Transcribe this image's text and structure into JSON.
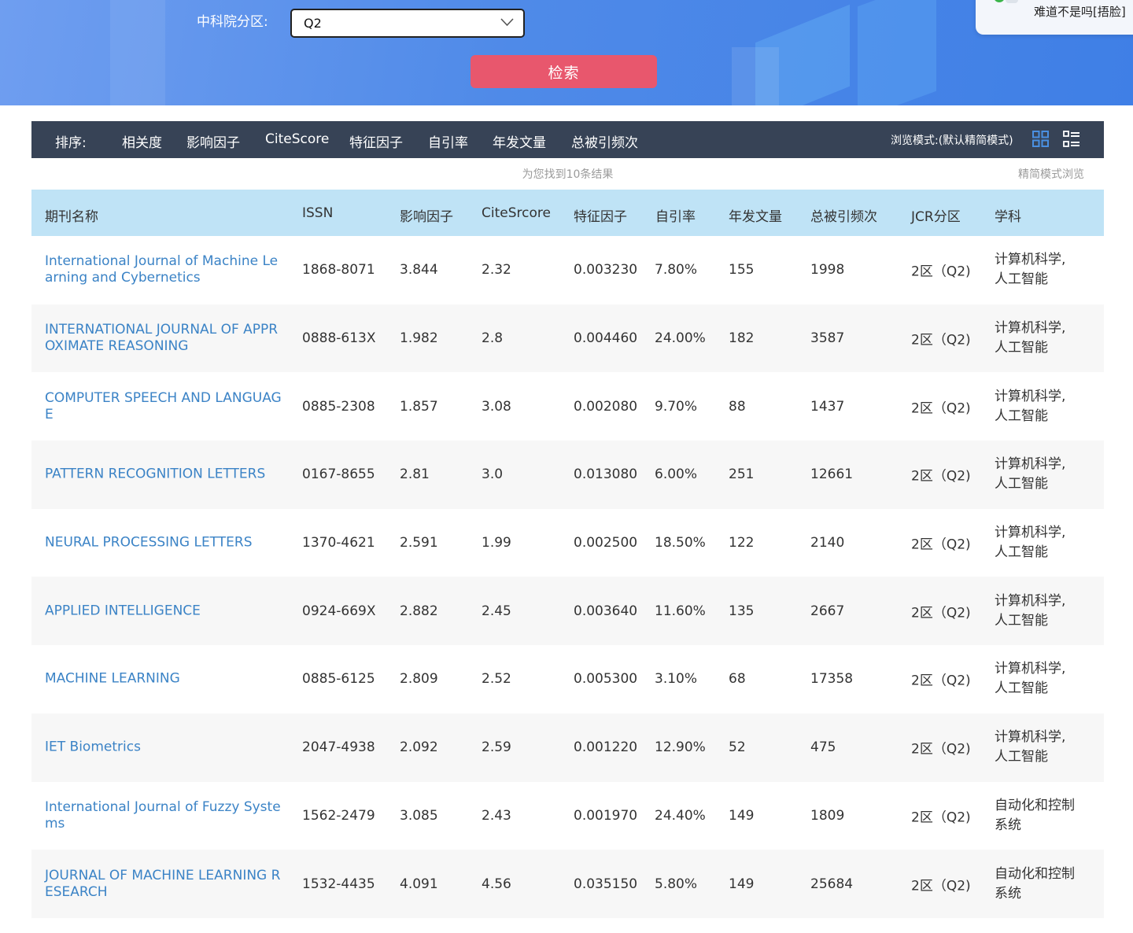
{
  "filter": {
    "label": "中科院分区:",
    "selected": "Q2",
    "search_button": "检索"
  },
  "notification": {
    "text": "难道不是吗[捂脸]"
  },
  "sortbar": {
    "label": "排序:",
    "options": [
      "相关度",
      "影响因子",
      "CiteScore",
      "特征因子",
      "自引率",
      "年发文量",
      "总被引频次"
    ],
    "view_mode_label": "浏览模式:(默认精简模式)",
    "icons": [
      "grid-view-icon",
      "list-view-icon"
    ],
    "icon_color": "#4a90e2"
  },
  "results": {
    "count_text": "为您找到10条结果",
    "simple_mode_text": "精简模式浏览"
  },
  "table": {
    "columns": [
      "期刊名称",
      "ISSN",
      "影响因子",
      "CiteSrcore",
      "特征因子",
      "自引率",
      "年发文量",
      "总被引频次",
      "JCR分区",
      "学科"
    ],
    "rows": [
      {
        "name": "International Journal of Machine Learning and Cybernetics",
        "issn": "1868-8071",
        "if": "3.844",
        "citescore": "2.32",
        "eigen": "0.003230",
        "self": "7.80%",
        "annual": "155",
        "cites": "1998",
        "jcr": "2区（Q2)",
        "subject": "计算机科学, 人工智能"
      },
      {
        "name": "INTERNATIONAL JOURNAL OF APPROXIMATE REASONING",
        "issn": "0888-613X",
        "if": "1.982",
        "citescore": "2.8",
        "eigen": "0.004460",
        "self": "24.00%",
        "annual": "182",
        "cites": "3587",
        "jcr": "2区（Q2)",
        "subject": "计算机科学, 人工智能"
      },
      {
        "name": "COMPUTER SPEECH AND LANGUAGE",
        "issn": "0885-2308",
        "if": "1.857",
        "citescore": "3.08",
        "eigen": "0.002080",
        "self": "9.70%",
        "annual": "88",
        "cites": "1437",
        "jcr": "2区（Q2)",
        "subject": "计算机科学, 人工智能"
      },
      {
        "name": "PATTERN RECOGNITION LETTERS",
        "issn": "0167-8655",
        "if": "2.81",
        "citescore": "3.0",
        "eigen": "0.013080",
        "self": "6.00%",
        "annual": "251",
        "cites": "12661",
        "jcr": "2区（Q2)",
        "subject": "计算机科学, 人工智能"
      },
      {
        "name": "NEURAL PROCESSING LETTERS",
        "issn": "1370-4621",
        "if": "2.591",
        "citescore": "1.99",
        "eigen": "0.002500",
        "self": "18.50%",
        "annual": "122",
        "cites": "2140",
        "jcr": "2区（Q2)",
        "subject": "计算机科学, 人工智能"
      },
      {
        "name": "APPLIED INTELLIGENCE",
        "issn": "0924-669X",
        "if": "2.882",
        "citescore": "2.45",
        "eigen": "0.003640",
        "self": "11.60%",
        "annual": "135",
        "cites": "2667",
        "jcr": "2区（Q2)",
        "subject": "计算机科学, 人工智能"
      },
      {
        "name": "MACHINE LEARNING",
        "issn": "0885-6125",
        "if": "2.809",
        "citescore": "2.52",
        "eigen": "0.005300",
        "self": "3.10%",
        "annual": "68",
        "cites": "17358",
        "jcr": "2区（Q2)",
        "subject": "计算机科学, 人工智能"
      },
      {
        "name": "IET Biometrics",
        "issn": "2047-4938",
        "if": "2.092",
        "citescore": "2.59",
        "eigen": "0.001220",
        "self": "12.90%",
        "annual": "52",
        "cites": "475",
        "jcr": "2区（Q2)",
        "subject": "计算机科学, 人工智能"
      },
      {
        "name": "International Journal of Fuzzy Systems",
        "issn": "1562-2479",
        "if": "3.085",
        "citescore": "2.43",
        "eigen": "0.001970",
        "self": "24.40%",
        "annual": "149",
        "cites": "1809",
        "jcr": "2区（Q2)",
        "subject": "自动化和控制系统"
      },
      {
        "name": "JOURNAL OF MACHINE LEARNING RESEARCH",
        "issn": "1532-4435",
        "if": "4.091",
        "citescore": "4.56",
        "eigen": "0.035150",
        "self": "5.80%",
        "annual": "149",
        "cites": "25684",
        "jcr": "2区（Q2)",
        "subject": "自动化和控制系统"
      }
    ]
  },
  "colors": {
    "banner": "#4f8ae8",
    "search_button": "#e8576d",
    "sortbar": "#374356",
    "table_header": "#bfe3f6",
    "link": "#3b83c6"
  }
}
